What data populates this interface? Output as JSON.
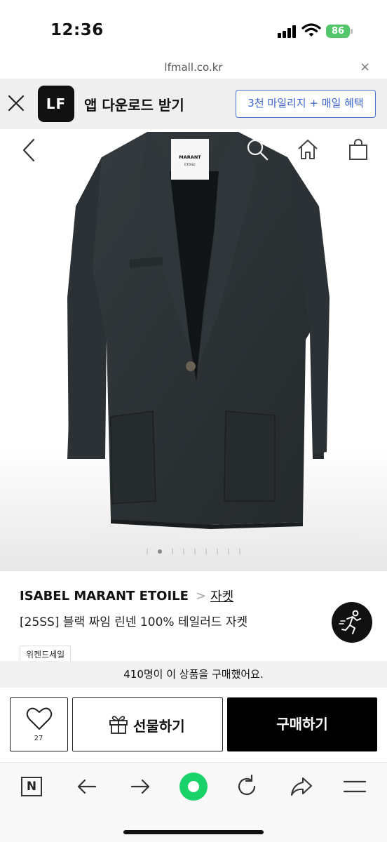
{
  "status_bar": {
    "time": "12:36",
    "battery": "86"
  },
  "url_bar": {
    "domain": "lfmall.co.kr",
    "close_glyph": "×"
  },
  "app_banner": {
    "logo_text": "LF",
    "title": "앱 다운로드 받기",
    "cta": "3천 마일리지 + 매일 혜택"
  },
  "product_image": {
    "label_brand": "MARANT",
    "label_sub": "ETOILE",
    "carousel": {
      "total": 9,
      "active_index": 1
    }
  },
  "product": {
    "brand": "ISABEL MARANT ETOILE",
    "crumb_sep": ">",
    "category": "자켓",
    "title": "[25SS] 블랙 짜임 린넨 100% 테일러드 자켓",
    "badge": "위켄드세일"
  },
  "notice": "410명이 이 상품을 구매했어요.",
  "actions": {
    "like_count": "27",
    "gift": "선물하기",
    "buy": "구매하기"
  },
  "toolbar": {
    "tab_letter": "N"
  },
  "colors": {
    "accent_blue": "#3b65cc",
    "green_button": "#19d36a",
    "battery_green": "#53c66c",
    "jacket": "#2b3134"
  }
}
